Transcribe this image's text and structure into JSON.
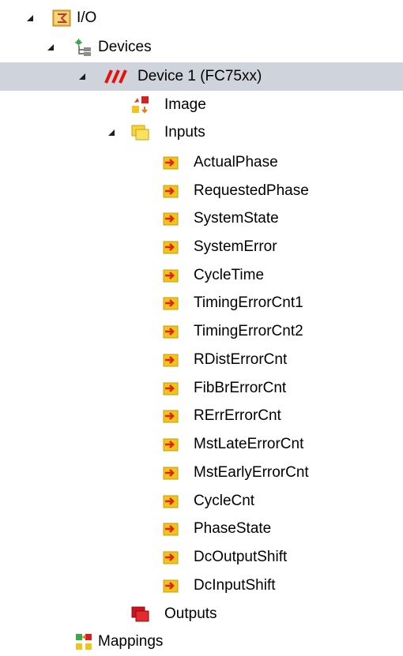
{
  "tree": {
    "root": {
      "label": "I/O",
      "expanded": true,
      "icon": "io-folder-icon"
    },
    "devices": {
      "label": "Devices",
      "expanded": true,
      "icon": "devices-icon"
    },
    "device1": {
      "label": "Device 1 (FC75xx)",
      "expanded": true,
      "selected": true,
      "icon": "ethercat-device-icon"
    },
    "image": {
      "label": "Image",
      "icon": "image-icon"
    },
    "inputs": {
      "label": "Inputs",
      "expanded": true,
      "icon": "inputs-folder-icon",
      "items": [
        "ActualPhase",
        "RequestedPhase",
        "SystemState",
        "SystemError",
        "CycleTime",
        "TimingErrorCnt1",
        "TimingErrorCnt2",
        "RDistErrorCnt",
        "FibBrErrorCnt",
        "RErrErrorCnt",
        "MstLateErrorCnt",
        "MstEarlyErrorCnt",
        "CycleCnt",
        "PhaseState",
        "DcOutputShift",
        "DcInputShift"
      ]
    },
    "outputs": {
      "label": "Outputs",
      "icon": "outputs-folder-icon"
    },
    "mappings": {
      "label": "Mappings",
      "icon": "mappings-icon"
    }
  }
}
